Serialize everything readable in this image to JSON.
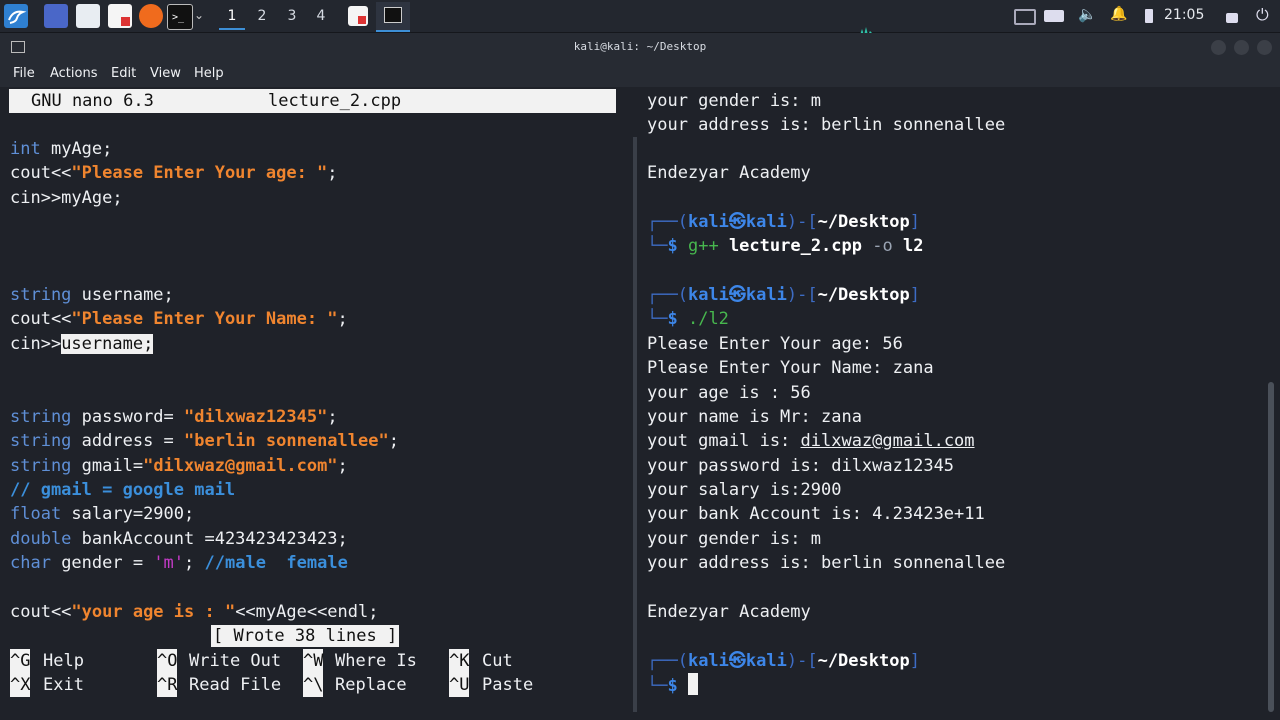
{
  "taskbar": {
    "workspaces": [
      "1",
      "2",
      "3",
      "4"
    ],
    "active_workspace": "1",
    "clock": "21:05",
    "icons": [
      "kali-menu-icon",
      "desktop-icon",
      "file-manager-icon",
      "text-editor-icon",
      "firefox-icon",
      "terminal-icon",
      "dropdown-chevron-icon"
    ],
    "tray_icons": [
      "network-icon",
      "camera-icon",
      "volume-icon",
      "bell-icon",
      "battery-icon",
      "lock-icon",
      "power-icon"
    ]
  },
  "window": {
    "title": "kali@kali: ~/Desktop",
    "menu": [
      "File",
      "Actions",
      "Edit",
      "View",
      "Help"
    ]
  },
  "nano": {
    "version": "GNU nano 6.3",
    "filename": "lecture_2.cpp",
    "status": "[ Wrote 38 lines ]",
    "code": {
      "l1_kw": "int",
      "l1_rest": " myAge;",
      "l2_a": "cout<<",
      "l2_str": "\"Please Enter Your age: \"",
      "l2_b": ";",
      "l3": "cin>>myAge;",
      "l4_kw": "string",
      "l4_rest": " username;",
      "l5_a": "cout<<",
      "l5_str": "\"Please Enter Your Name: \"",
      "l5_b": ";",
      "l6_a": "cin>>",
      "l6_sel": "username;",
      "l7_kw": "string",
      "l7_a": " password= ",
      "l7_str": "\"dilxwaz12345\"",
      "l7_b": ";",
      "l8_kw": "string",
      "l8_a": " address = ",
      "l8_str": "\"berlin sonnenallee\"",
      "l8_b": ";",
      "l9_kw": "string",
      "l9_a": " gmail=",
      "l9_str": "\"dilxwaz@gmail.com\"",
      "l9_b": ";",
      "l10_cmt": "// gmail = google mail",
      "l11_kw": "float",
      "l11_rest": " salary=2900;",
      "l12_kw": "double",
      "l12_rest": " bankAccount =423423423423;",
      "l13_kw": "char",
      "l13_a": " gender = ",
      "l13_chr": "'m'",
      "l13_b": "; ",
      "l13_cmt": "//male  female",
      "l14_a": "cout<<",
      "l14_str": "\"your age is : \"",
      "l14_b": "<<myAge<<endl;"
    },
    "shortcuts": [
      {
        "key": "^G",
        "label": "Help"
      },
      {
        "key": "^O",
        "label": "Write Out"
      },
      {
        "key": "^W",
        "label": "Where Is"
      },
      {
        "key": "^K",
        "label": "Cut"
      },
      {
        "key": "^X",
        "label": "Exit"
      },
      {
        "key": "^R",
        "label": "Read File"
      },
      {
        "key": "^\\",
        "label": "Replace"
      },
      {
        "key": "^U",
        "label": "Paste"
      }
    ]
  },
  "output": {
    "top_1": "your gender is: m",
    "top_2": "your address is: berlin sonnenallee",
    "academy_1": "Endezyar Academy",
    "prompt_user": "kali",
    "prompt_symbol": "㉿",
    "prompt_host": "kali",
    "prompt_dir": "~/Desktop",
    "cmd1_tool": "g++",
    "cmd1_file": "lecture_2.cpp",
    "cmd1_opt": "-o",
    "cmd1_out": "l2",
    "cmd2": "./l2",
    "run_lines": [
      "Please Enter Your age: 56",
      "Please Enter Your Name: zana",
      "your age is : 56",
      "your name is Mr: zana",
      "yout gmail is: dilxwaz@gmail.com",
      "your password is: dilxwaz12345",
      "your salary is:2900",
      "your bank Account is: 4.23423e+11",
      "your gender is: m",
      "your address is: berlin sonnenallee"
    ],
    "gmail_prefix": "yout gmail is: ",
    "gmail_value": "dilxwaz@gmail.com",
    "academy_2": "Endezyar Academy"
  }
}
